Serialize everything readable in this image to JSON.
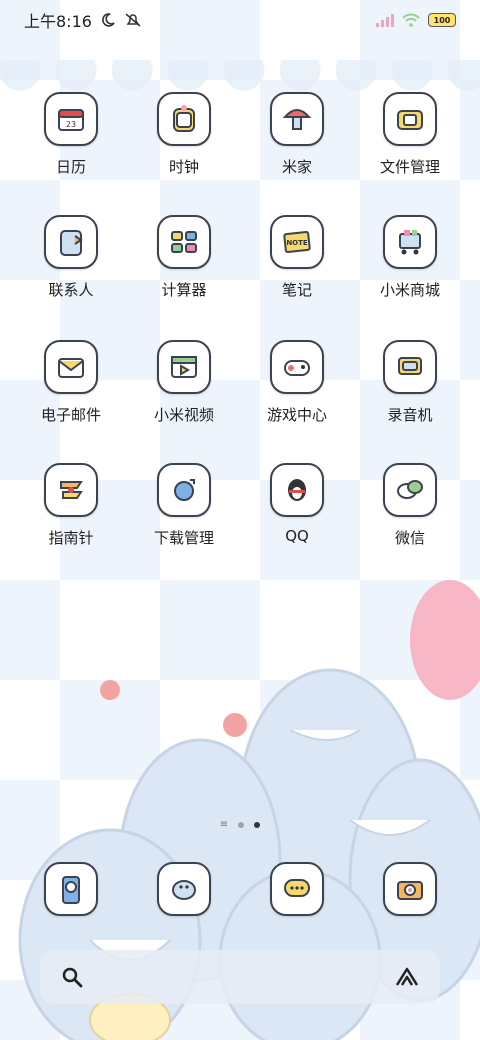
{
  "status_bar": {
    "time": "上午8:16",
    "battery": "100",
    "icons": [
      "moon-icon",
      "bell-muted-icon",
      "signal-icon",
      "wifi-icon",
      "battery-icon"
    ]
  },
  "apps": [
    {
      "label": "日历",
      "icon": "calendar-icon",
      "accent": "#e74c4c"
    },
    {
      "label": "时钟",
      "icon": "clock-icon",
      "accent": "#f4a3b6"
    },
    {
      "label": "米家",
      "icon": "home-icon",
      "accent": "#e96b6b"
    },
    {
      "label": "文件管理",
      "icon": "folder-icon",
      "accent": "#f6d86d"
    },
    {
      "label": "联系人",
      "icon": "contacts-icon",
      "accent": "#7fb0e8"
    },
    {
      "label": "计算器",
      "icon": "calculator-icon",
      "accent": "#9ad08f"
    },
    {
      "label": "笔记",
      "icon": "note-icon",
      "accent": "#f6d86d"
    },
    {
      "label": "小米商城",
      "icon": "shopping-cart-icon",
      "accent": "#f28cab"
    },
    {
      "label": "电子邮件",
      "icon": "mail-icon",
      "accent": "#f6d86d"
    },
    {
      "label": "小米视频",
      "icon": "video-icon",
      "accent": "#9ad08f"
    },
    {
      "label": "游戏中心",
      "icon": "gamepad-icon",
      "accent": "#e96b6b"
    },
    {
      "label": "录音机",
      "icon": "recorder-icon",
      "accent": "#f6d86d"
    },
    {
      "label": "指南针",
      "icon": "compass-icon",
      "accent": "#f6b55f"
    },
    {
      "label": "下载管理",
      "icon": "download-icon",
      "accent": "#7fb0e8"
    },
    {
      "label": "QQ",
      "icon": "penguin-icon",
      "accent": "#e74c4c"
    },
    {
      "label": "微信",
      "icon": "chat-bubble-icon",
      "accent": "#9ad08f"
    }
  ],
  "dock": [
    {
      "icon": "phone-icon",
      "accent": "#7fb0e8"
    },
    {
      "icon": "messages-icon",
      "accent": "#9aa3ad"
    },
    {
      "icon": "chat-icon",
      "accent": "#f6d86d"
    },
    {
      "icon": "camera-icon",
      "accent": "#f6b55f"
    }
  ],
  "pager": {
    "pages": 2,
    "active": 2
  },
  "search": {
    "left_icon": "search-icon",
    "right_icon": "assistant-icon"
  }
}
